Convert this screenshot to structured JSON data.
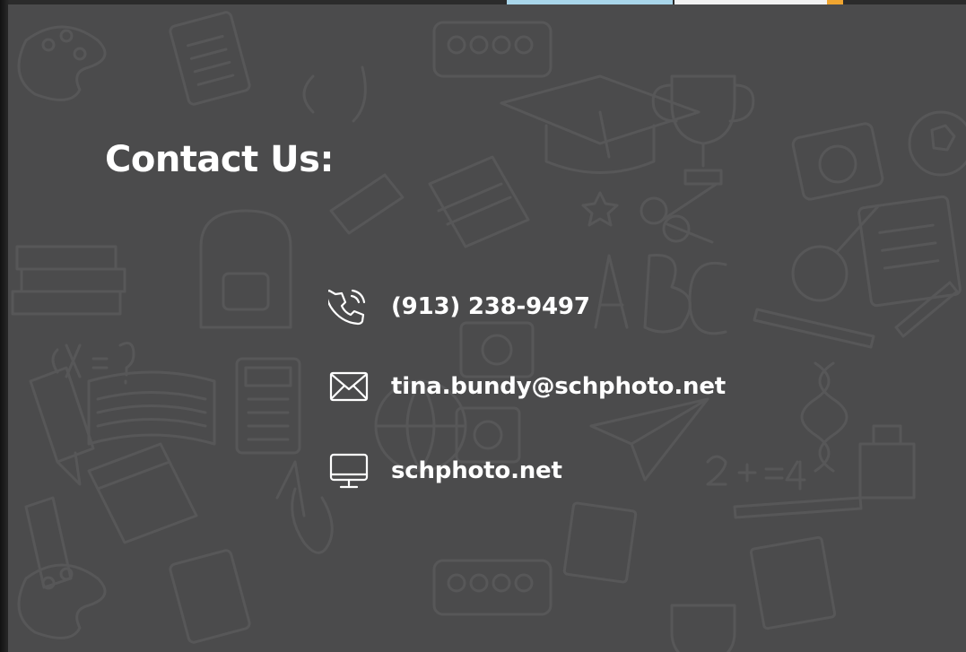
{
  "section": {
    "title": "Contact Us:"
  },
  "contacts": {
    "phone": {
      "icon": "phone-icon",
      "value": "(913) 238-9497"
    },
    "email": {
      "icon": "envelope-icon",
      "value": "tina.bundy@schphoto.net"
    },
    "website": {
      "icon": "monitor-icon",
      "value": "schphoto.net"
    }
  },
  "colors": {
    "panel_background": "#4b4b4c",
    "text": "#ffffff",
    "doodle_stroke": "#575758"
  }
}
